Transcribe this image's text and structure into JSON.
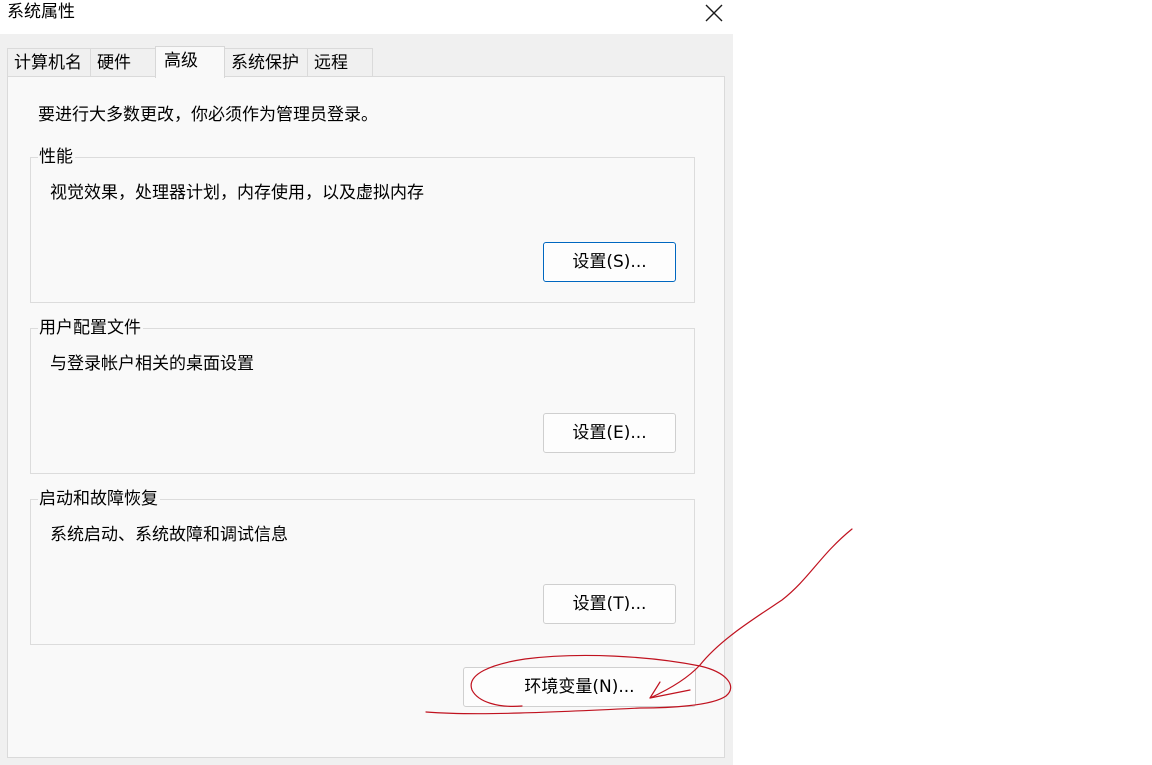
{
  "window": {
    "title": "系统属性"
  },
  "tabs": [
    {
      "label": "计算机名"
    },
    {
      "label": "硬件"
    },
    {
      "label": "高级"
    },
    {
      "label": "系统保护"
    },
    {
      "label": "远程"
    }
  ],
  "advanced": {
    "admin_note": "要进行大多数更改，你必须作为管理员登录。",
    "performance": {
      "label": "性能",
      "description": "视觉效果，处理器计划，内存使用，以及虚拟内存",
      "button": "设置(S)..."
    },
    "user_profiles": {
      "label": "用户配置文件",
      "description": "与登录帐户相关的桌面设置",
      "button": "设置(E)..."
    },
    "startup_recovery": {
      "label": "启动和故障恢复",
      "description": "系统启动、系统故障和调试信息",
      "button": "设置(T)..."
    },
    "env_button": "环境变量(N)..."
  },
  "colors": {
    "annotation_ink": "#c0121f",
    "default_button_border": "#0067c0"
  },
  "icons": {
    "close": "close-icon"
  }
}
